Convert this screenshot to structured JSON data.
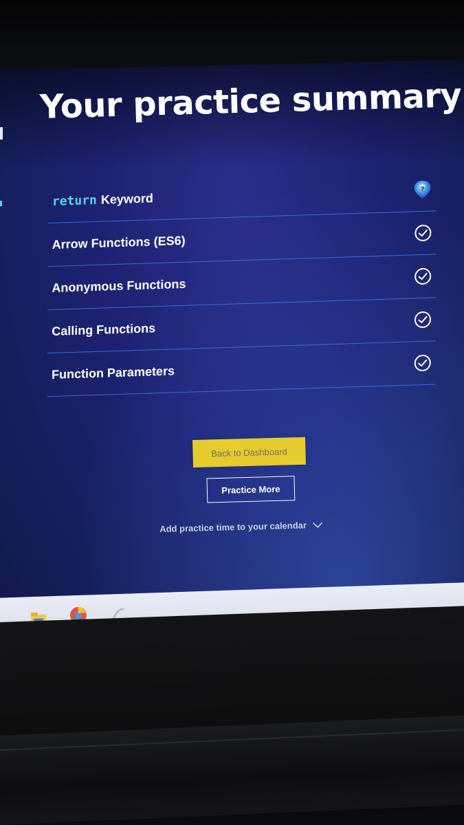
{
  "page": {
    "title": "Your practice summary"
  },
  "summary": {
    "items": [
      {
        "keyword": "return",
        "label": "Keyword",
        "icon": "gem-icon",
        "status": "in-progress"
      },
      {
        "keyword": "",
        "label": "Arrow Functions (ES6)",
        "icon": "check-circle-icon",
        "status": "complete"
      },
      {
        "keyword": "",
        "label": "Anonymous Functions",
        "icon": "check-circle-icon",
        "status": "complete"
      },
      {
        "keyword": "",
        "label": "Calling Functions",
        "icon": "check-circle-icon",
        "status": "complete"
      },
      {
        "keyword": "",
        "label": "Function Parameters",
        "icon": "check-circle-icon",
        "status": "complete"
      }
    ]
  },
  "actions": {
    "back_label": "Back to Dashboard",
    "practice_more_label": "Practice More",
    "calendar_label": "Add practice time to your calendar"
  },
  "colors": {
    "background": "#1d2273",
    "keyword": "#4fd6ef",
    "divider": "#3a6cd8",
    "primary_button": "#e5cb2d",
    "text": "#ffffff"
  }
}
